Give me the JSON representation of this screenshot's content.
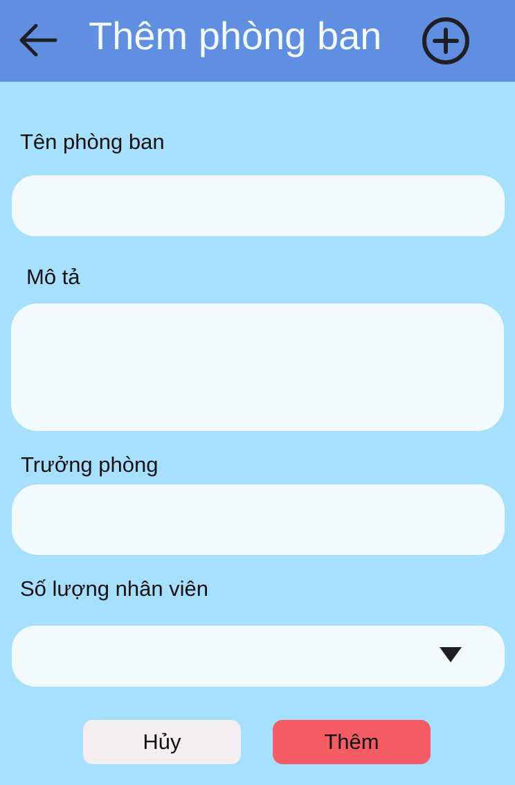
{
  "header": {
    "back_icon": "arrow-left-icon",
    "title": "Thêm phòng ban",
    "add_icon": "plus-circle-icon",
    "color": "#608EE0"
  },
  "form": {
    "name_label": "Tên phòng ban",
    "name_value": "",
    "description_label": "Mô tả",
    "description_value": "",
    "manager_label": "Trưởng phòng",
    "manager_value": "",
    "employee_count_label": "Số lượng nhân viên",
    "employee_count_value": "",
    "dropdown_icon": "caret-down-icon"
  },
  "actions": {
    "cancel_label": "Hủy",
    "submit_label": "Thêm",
    "cancel_color": "#F4EEF1",
    "submit_color": "#F65C64"
  },
  "colors": {
    "background": "#A6E0FE",
    "field": "#F2FAFD"
  }
}
